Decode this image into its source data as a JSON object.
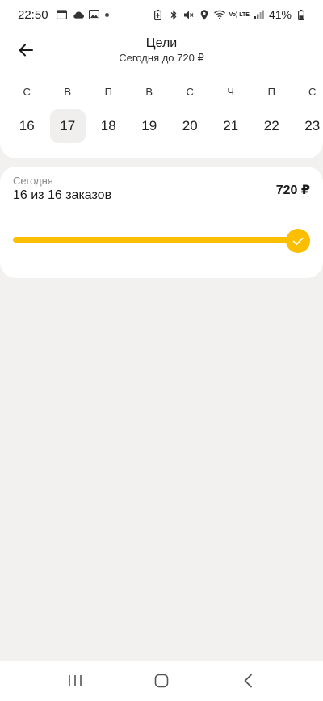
{
  "status_bar": {
    "time": "22:50",
    "battery_percent": "41%",
    "network_label": "Vo) LTE",
    "left_icons": [
      "calendar-icon",
      "cloud-icon",
      "image-icon",
      "dot-icon"
    ],
    "right_icons": [
      "battery-saver-icon",
      "bluetooth-icon",
      "mute-icon",
      "location-icon",
      "wifi-icon",
      "signal-icon",
      "battery-icon"
    ]
  },
  "header": {
    "title": "Цели",
    "subtitle": "Сегодня до 720 ₽"
  },
  "calendar": {
    "weekdays": [
      "С",
      "В",
      "П",
      "В",
      "С",
      "Ч",
      "П",
      "С"
    ],
    "days": [
      "16",
      "17",
      "18",
      "19",
      "20",
      "21",
      "22",
      "23"
    ],
    "selected_index": 1
  },
  "goal": {
    "label": "Сегодня",
    "progress_text": "16 из 16 заказов",
    "amount": "720 ₽",
    "progress_fraction": 1.0,
    "accent_color": "#fcbf00"
  },
  "navbar": {
    "icons": [
      "recent-apps-icon",
      "home-icon",
      "back-icon"
    ]
  }
}
